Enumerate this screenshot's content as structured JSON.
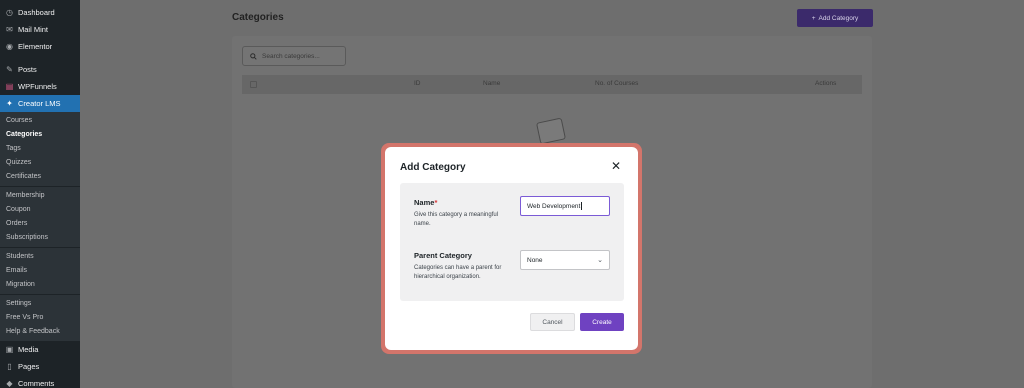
{
  "sidebar": {
    "top_items": [
      {
        "label": "Dashboard",
        "icon": "dashboard-icon"
      },
      {
        "label": "Mail Mint",
        "icon": "mail-icon"
      },
      {
        "label": "Elementor",
        "icon": "elementor-icon"
      }
    ],
    "mid_items": [
      {
        "label": "Posts",
        "icon": "pin-icon"
      },
      {
        "label": "WPFunnels",
        "icon": "funnel-icon"
      }
    ],
    "active_item": {
      "label": "Creator LMS",
      "icon": "lms-icon"
    },
    "submenu": [
      [
        "Courses",
        "Categories",
        "Tags",
        "Quizzes",
        "Certificates"
      ],
      [
        "Membership",
        "Coupon",
        "Orders",
        "Subscriptions"
      ],
      [
        "Students",
        "Emails",
        "Migration"
      ],
      [
        "Settings",
        "Free Vs Pro",
        "Help & Feedback"
      ]
    ],
    "bottom_items": [
      {
        "label": "Media",
        "icon": "media-icon"
      },
      {
        "label": "Pages",
        "icon": "pages-icon"
      },
      {
        "label": "Comments",
        "icon": "comments-icon"
      }
    ]
  },
  "page": {
    "title": "Categories",
    "add_button": "Add Category",
    "search_placeholder": "Search categories...",
    "columns": [
      "ID",
      "Name",
      "No. of Courses",
      "Actions"
    ]
  },
  "modal": {
    "title": "Add Category",
    "name_label": "Name",
    "name_required": "*",
    "name_desc": "Give this category a meaningful name.",
    "name_value": "Web Development",
    "parent_label": "Parent Category",
    "parent_desc": "Categories can have a parent for hierarchical organization.",
    "parent_value": "None",
    "cancel": "Cancel",
    "create": "Create"
  },
  "colors": {
    "accent": "#6f42c1",
    "sidebar_bg": "#1d2327",
    "active_menu": "#2271b1",
    "modal_ring": "#d3756b"
  }
}
